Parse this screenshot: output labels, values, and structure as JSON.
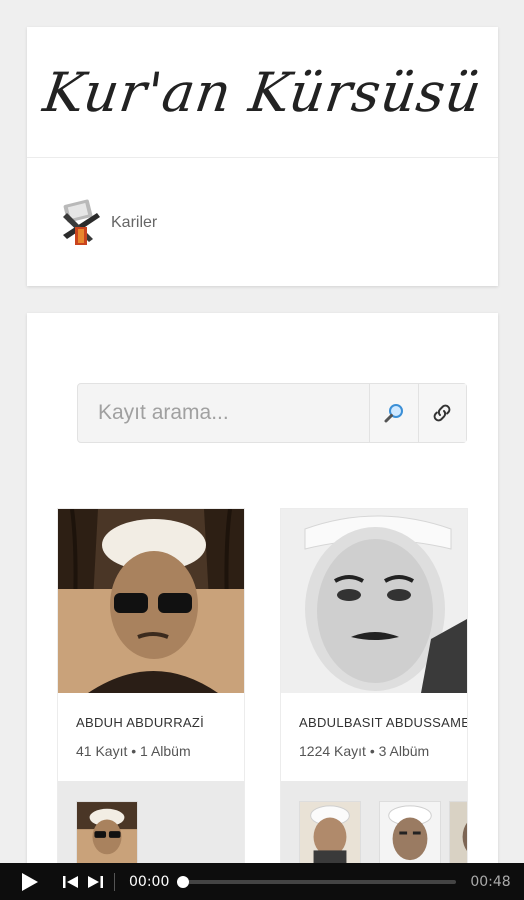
{
  "header": {
    "title": "Kur'an Kürsüsü",
    "nav": [
      {
        "label": "Kariler",
        "icon": "quran-stand-icon"
      }
    ]
  },
  "search": {
    "placeholder": "Kayıt arama...",
    "search_icon": "magnifier-icon",
    "link_icon": "link-icon"
  },
  "reciters": [
    {
      "name": "ABDUH ABDURRAZİ",
      "meta": "41 Kayıt • 1 Albüm"
    },
    {
      "name": "ABDULBASIT ABDUSSAMED",
      "meta": "1224 Kayıt • 3 Albüm"
    }
  ],
  "player": {
    "current_time": "00:00",
    "duration": "00:48",
    "progress": 0
  }
}
